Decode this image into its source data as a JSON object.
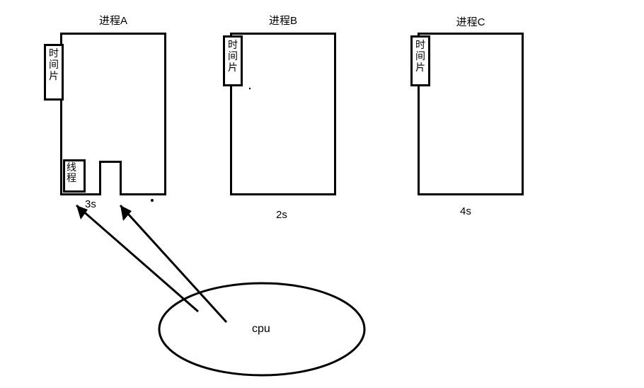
{
  "processes": {
    "a": {
      "title": "进程A",
      "timeslice": "时间片",
      "thread": "线程",
      "time": "3s"
    },
    "b": {
      "title": "进程B",
      "timeslice": "时间片",
      "time": "2s"
    },
    "c": {
      "title": "进程C",
      "timeslice": "时间片",
      "time": "4s"
    }
  },
  "cpu": {
    "label": "cpu"
  }
}
